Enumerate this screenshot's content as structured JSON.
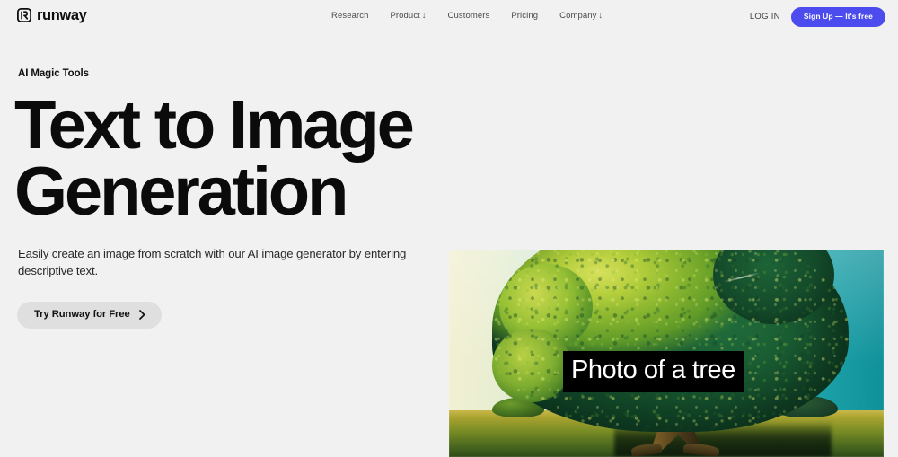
{
  "header": {
    "brand": {
      "name": "runway",
      "icon": "runway-logo-icon"
    },
    "nav": [
      {
        "label": "Research",
        "caret": ""
      },
      {
        "label": "Product",
        "caret": "↓"
      },
      {
        "label": "Customers",
        "caret": ""
      },
      {
        "label": "Pricing",
        "caret": ""
      },
      {
        "label": "Company",
        "caret": "↓"
      }
    ],
    "login_label": "LOG IN",
    "signup_label": "Sign Up — It's free",
    "signup_color": "#4b4bee"
  },
  "hero": {
    "eyebrow": "AI Magic Tools",
    "headline_line1": "Text to Image",
    "headline_line2": "Generation",
    "description": "Easily create an image from scratch with our AI image generator by entering descriptive text.",
    "cta_label": "Try Runway for Free",
    "cta_chevron_icon": "chevron-right-icon"
  },
  "media": {
    "caption": "Photo of a tree",
    "alt": "AI generated image of a large green tree in a field under a teal sky",
    "caption_bg": "#000000",
    "caption_color": "#ffffff"
  },
  "theme": {
    "page_background": "#f1f1f1",
    "text_primary": "#0b0b0b",
    "text_muted": "#4a4a4a",
    "cta_background": "#dfdfdf"
  }
}
